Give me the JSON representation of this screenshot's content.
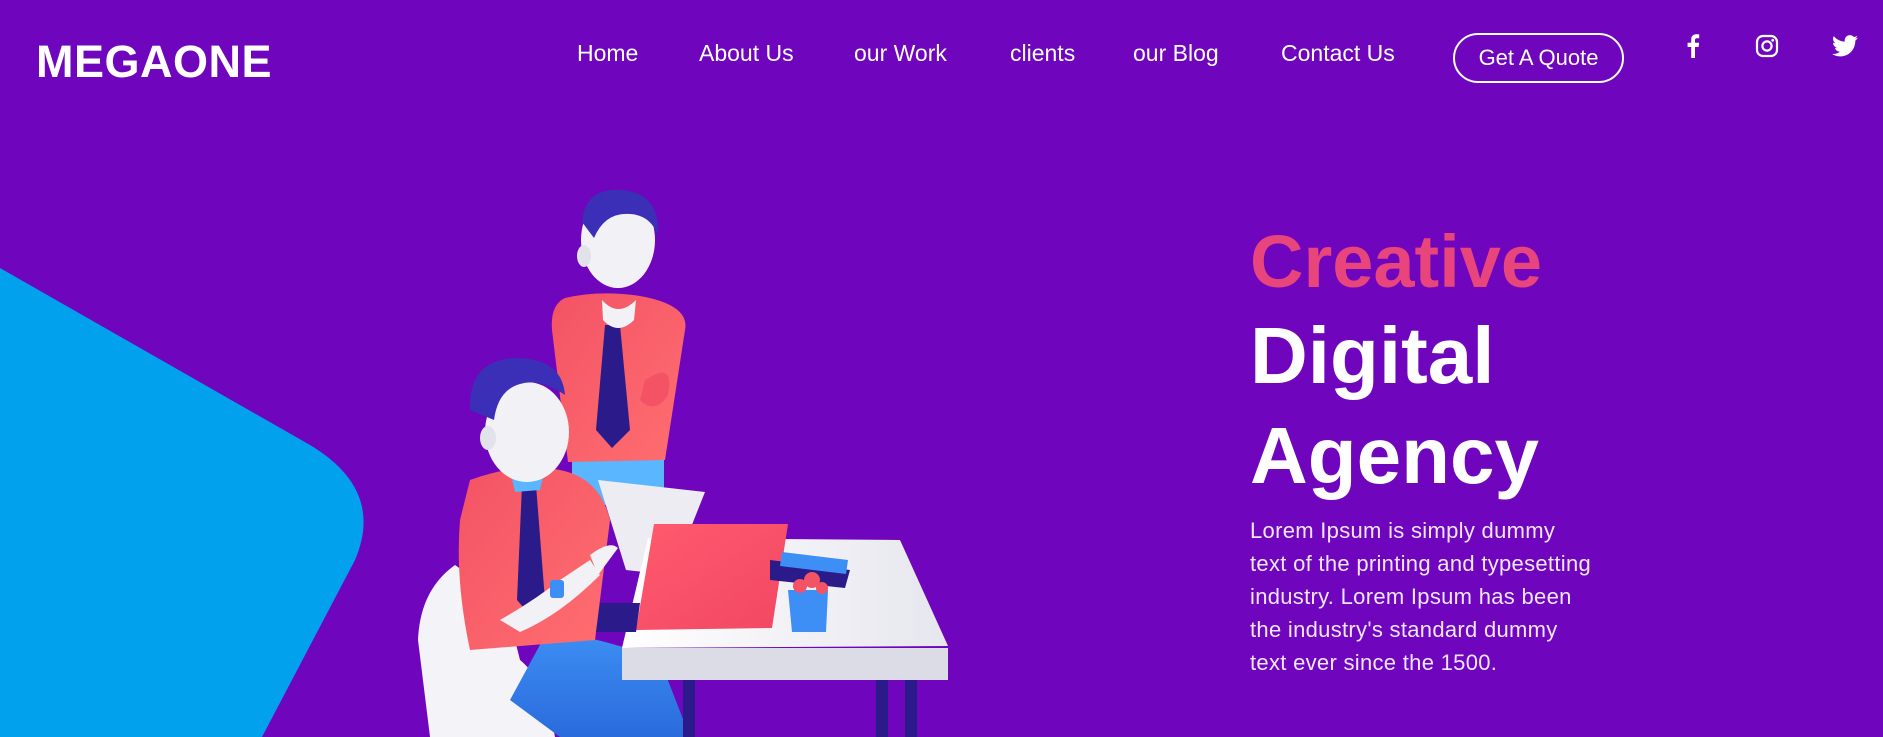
{
  "header": {
    "logo": "MEGAONE",
    "nav": [
      {
        "label": "Home"
      },
      {
        "label": "About Us"
      },
      {
        "label": "our Work"
      },
      {
        "label": "clients"
      },
      {
        "label": "our Blog"
      },
      {
        "label": "Contact Us"
      }
    ],
    "cta_label": "Get A Quote",
    "social_icons": [
      "facebook-icon",
      "instagram-icon",
      "twitter-icon"
    ]
  },
  "hero": {
    "eyebrow": "Creative",
    "title_line1": "Digital",
    "title_line2": "Agency",
    "paragraph": "Lorem Ipsum is simply dummy text of the printing and typesetting industry. Lorem Ipsum has been the industry's standard dummy text ever since the 1500."
  },
  "colors": {
    "background": "#6f05bd",
    "accent_pink": "#e8457c",
    "blob_blue": "#02a1ee",
    "figure_shirt": "#f35365",
    "figure_hair": "#3a2fb6"
  }
}
